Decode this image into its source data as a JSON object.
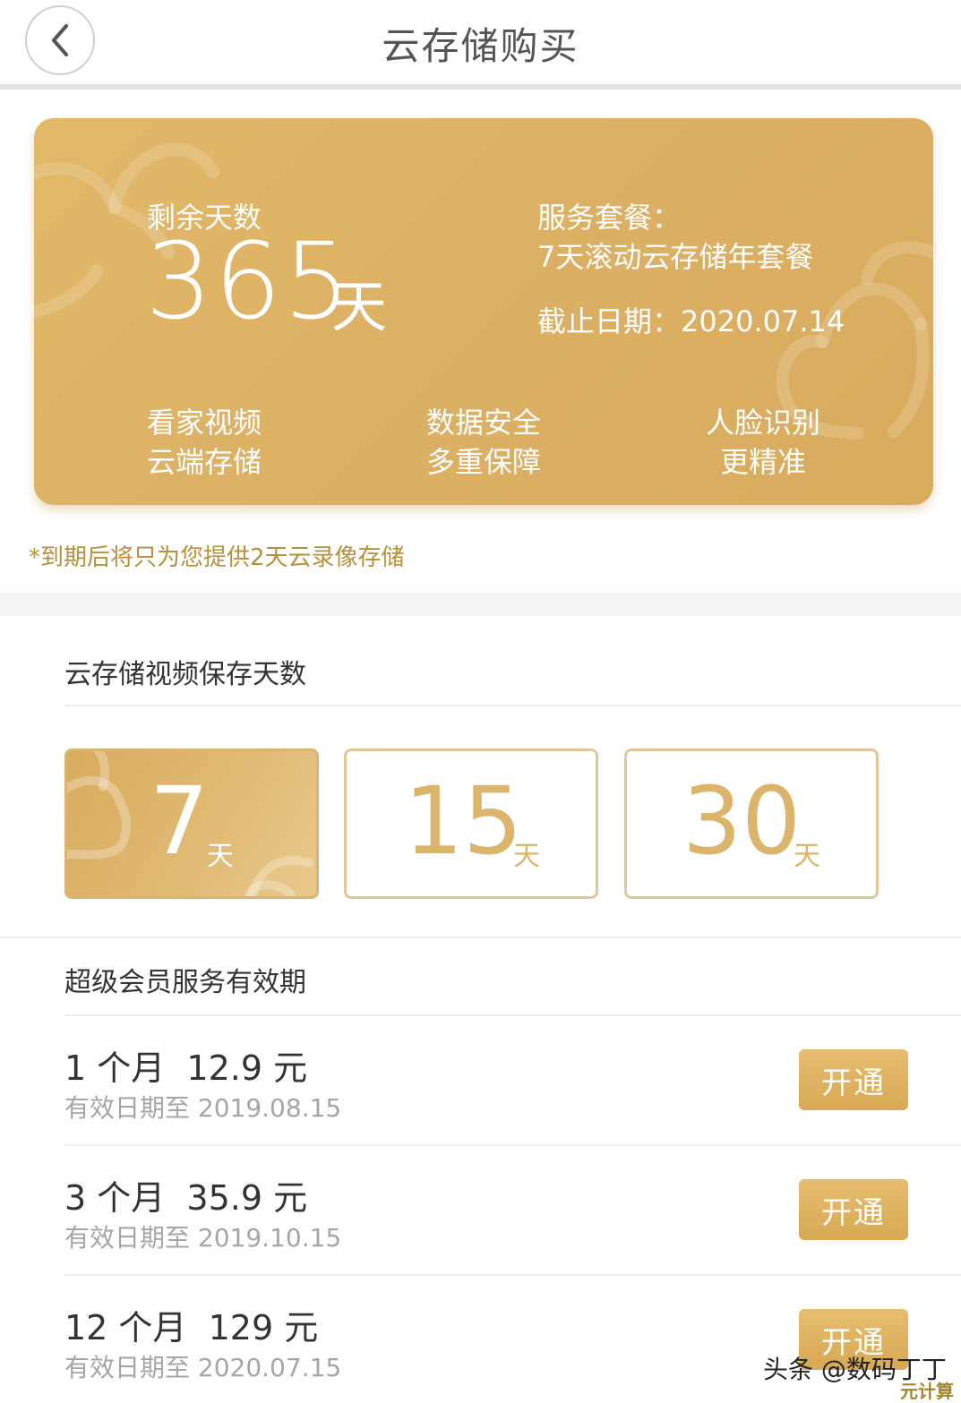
{
  "header": {
    "title": "云存储购买",
    "back_icon": "chevron-left-icon"
  },
  "card": {
    "remain_label": "剩余天数",
    "remain_days": "365",
    "remain_unit": "天",
    "plan_label": "服务套餐：",
    "plan_name": "7天滚动云存储年套餐",
    "expire": "截止日期：2020.07.14",
    "features": [
      {
        "line1": "看家视频",
        "line2": "云端存储"
      },
      {
        "line1": "数据安全",
        "line2": "多重保障"
      },
      {
        "line1": "人脸识别",
        "line2": "更精准"
      }
    ]
  },
  "notice": "*到期后将只为您提供2天云录像存储",
  "storage": {
    "title": "云存储视频保存天数",
    "options": [
      {
        "num": "7",
        "unit": "天",
        "selected": true
      },
      {
        "num": "15",
        "unit": "天",
        "selected": false
      },
      {
        "num": "30",
        "unit": "天",
        "selected": false
      }
    ]
  },
  "membership": {
    "title": "超级会员服务有效期",
    "rows": [
      {
        "price": "1 个月  12.9 元",
        "valid": "有效日期至 2019.08.15",
        "button": "开通"
      },
      {
        "price": "3 个月  35.9 元",
        "valid": "有效日期至 2019.10.15",
        "button": "开通"
      },
      {
        "price": "12 个月  129 元",
        "valid": "有效日期至 2020.07.15",
        "button": "开通"
      }
    ]
  },
  "watermark": {
    "text": "头条 @数码丁丁",
    "corner": "元计算"
  },
  "colors": {
    "gold": "#dcb064",
    "gold_text": "#dcb56c",
    "notice": "#b8903a"
  }
}
